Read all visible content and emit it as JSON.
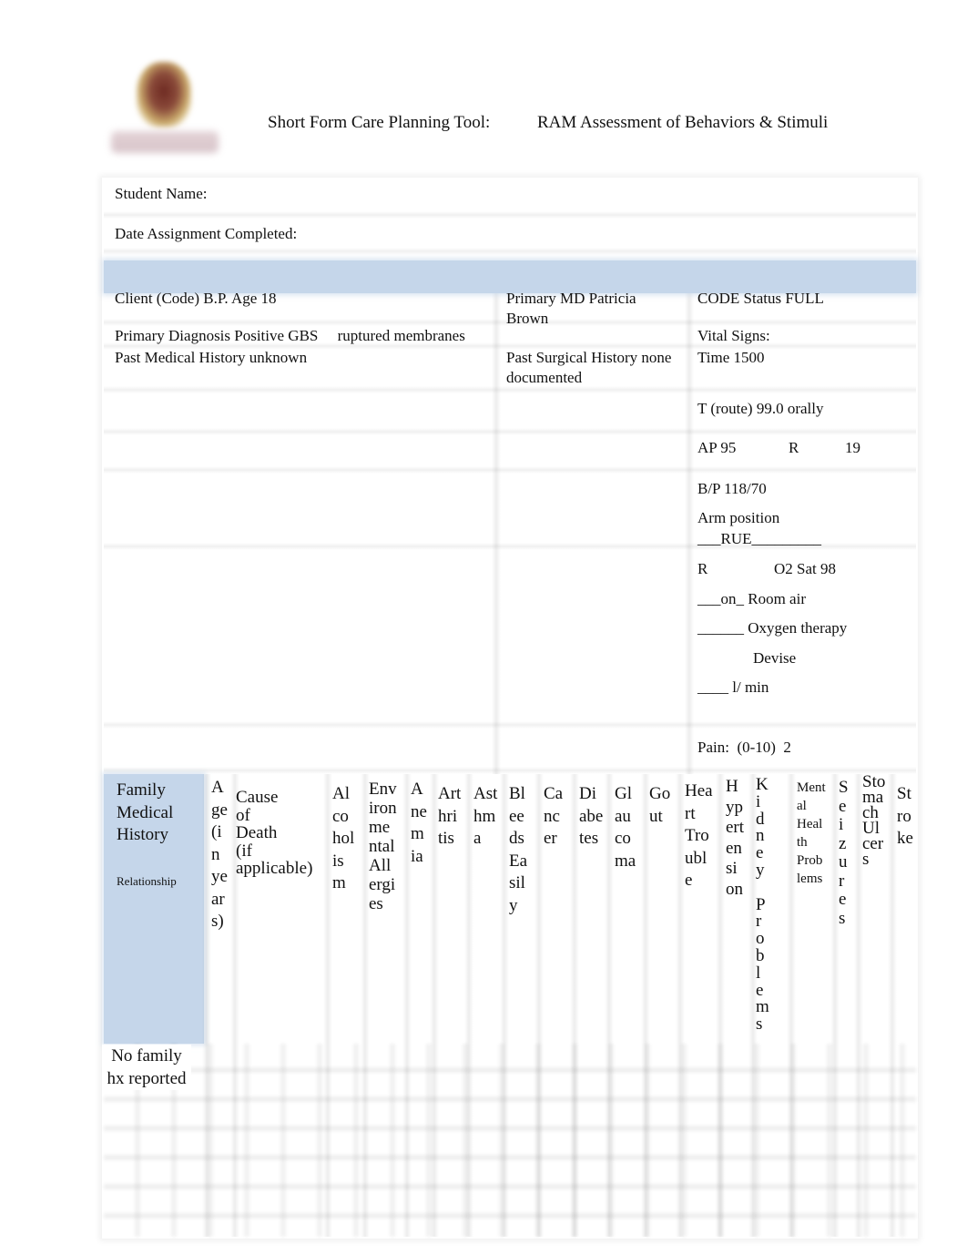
{
  "header": {
    "logo_icon": "school-crest-logo",
    "title_left": "Short Form Care Planning Tool:",
    "title_right": "RAM Assessment of Behaviors & Stimuli"
  },
  "student": {
    "name_label": "Student Name:",
    "date_label": "Date Assignment Completed:"
  },
  "client": {
    "client_code": "Client  (Code)  B.P.   Age 18",
    "primary_md": "Primary MD Patricia Brown",
    "code_status": "CODE Status FULL",
    "primary_diagnosis": "Primary Diagnosis Positive GBS     ruptured membranes",
    "vital_signs_label": "Vital Signs:",
    "past_medical_history": "Past Medical History unknown",
    "past_surgical_history": "Past Surgical History none documented",
    "time": "Time 1500"
  },
  "vitals": {
    "temperature": "T (route) 99.0 orally",
    "ap": "AP 95",
    "r_label": "R",
    "r_value": "19",
    "bp": "B/P 118/70",
    "arm_position_label": "Arm position",
    "arm_position_value": "___RUE_________",
    "r2_label": "R",
    "o2_sat": "O2 Sat 98",
    "room_air": "___on_ Room air",
    "oxygen_therapy": "______ Oxygen therapy",
    "devise": "Devise",
    "l_min": "____ l/ min",
    "pain": "Pain:  (0-10)  2"
  },
  "family_history": {
    "title": "Family Medical History",
    "relationship_label": "Relationship",
    "columns": [
      "Age (in years)",
      "Cause of Death (if applicable)",
      "Alcoholism",
      "Environmental Allergies",
      "Anemia",
      "Arthritis",
      "Asthma",
      "Bleeds Easily",
      "Cancer",
      "Diabetes",
      "Glaucoma",
      "Gout",
      "Heart Trouble",
      "Hypertension",
      "Kidney Problems",
      "Mental Health Problems",
      "Seizures",
      "Stomach Ulcers",
      "Stroke"
    ],
    "column_display": [
      "A\nge\n(i\nn\nye\nar\ns)",
      "Cause\nof\nDeath\n(if\napplicable)",
      "Al\nco\nhol\nis\nm",
      "Env\niron\nme\nntal\nAll\nergi\nes",
      "A\nne\nm\nia",
      "Art\nhri\ntis",
      "Ast\nhm\na",
      "Bl\nee\nds\nEa\nsil\ny",
      "Ca\nnc\ner",
      "Di\nabe\ntes",
      "Gl\nau\nco\nma",
      "Go\nut",
      "Hea\nrt\nTro\nubl\ne",
      "H\nyp\nert\nen\nsi\non",
      "K\ni\nd\nn\ne\ny\n \nP\nr\no\nb\nl\ne\nm\ns",
      "Ment\nal\nHeal\nth\nProb\nlems",
      "S\ne\ni\nz\nu\nr\ne\ns",
      "Sto\nma\nch\nUl\ncer\ns",
      "St\nro\nke"
    ],
    "first_entry": "No family hx reported"
  }
}
